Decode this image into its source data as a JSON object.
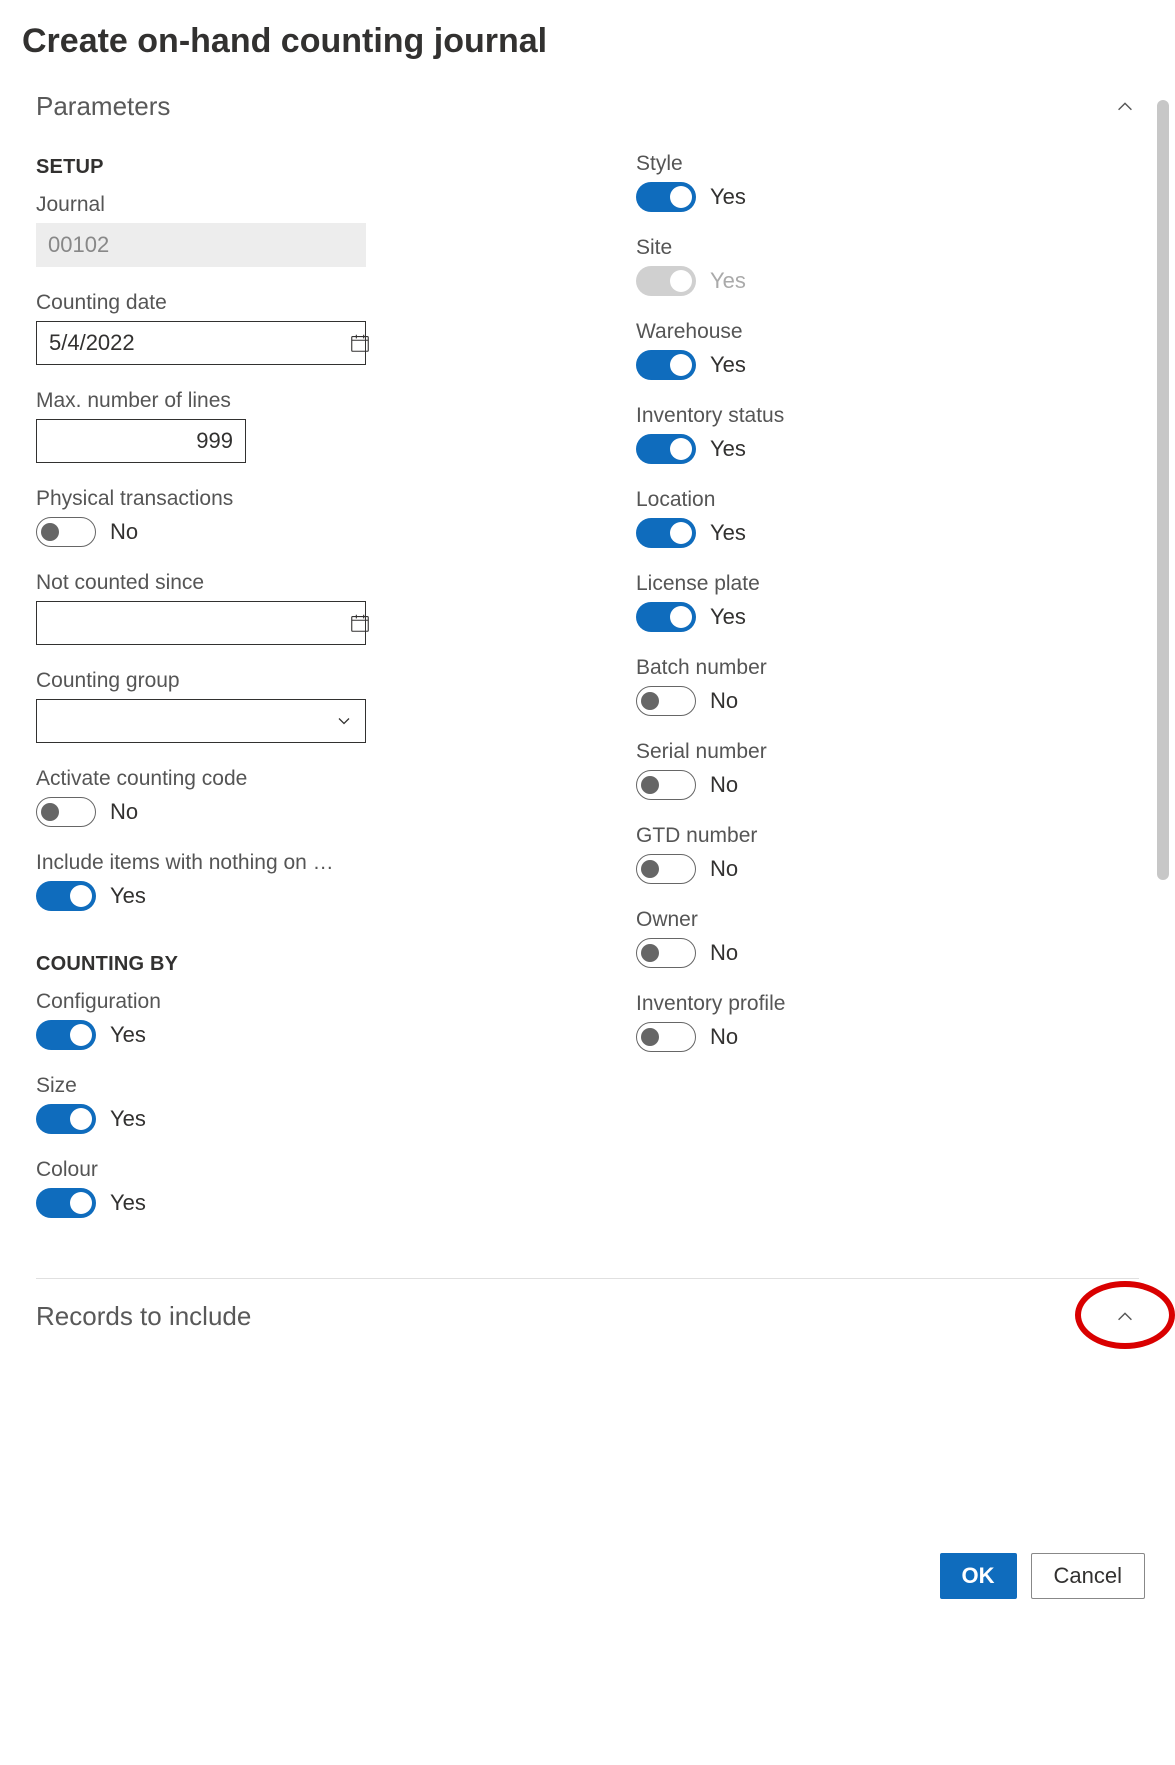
{
  "title": "Create on-hand counting journal",
  "sections": {
    "parameters": {
      "label": "Parameters"
    },
    "records": {
      "label": "Records to include"
    }
  },
  "setup": {
    "heading": "SETUP",
    "journal": {
      "label": "Journal",
      "value": "00102"
    },
    "counting_date": {
      "label": "Counting date",
      "value": "5/4/2022"
    },
    "max_lines": {
      "label": "Max. number of lines",
      "value": "999"
    },
    "physical_transactions": {
      "label": "Physical transactions",
      "value": "No"
    },
    "not_counted_since": {
      "label": "Not counted since",
      "value": ""
    },
    "counting_group": {
      "label": "Counting group",
      "value": ""
    },
    "activate_counting_code": {
      "label": "Activate counting code",
      "value": "No"
    },
    "include_zero": {
      "label": "Include items with nothing on …",
      "value": "Yes"
    }
  },
  "counting_by": {
    "heading": "COUNTING BY",
    "configuration": {
      "label": "Configuration",
      "value": "Yes"
    },
    "size": {
      "label": "Size",
      "value": "Yes"
    },
    "colour": {
      "label": "Colour",
      "value": "Yes"
    },
    "style": {
      "label": "Style",
      "value": "Yes"
    },
    "site": {
      "label": "Site",
      "value": "Yes"
    },
    "warehouse": {
      "label": "Warehouse",
      "value": "Yes"
    },
    "inventory_status": {
      "label": "Inventory status",
      "value": "Yes"
    },
    "location": {
      "label": "Location",
      "value": "Yes"
    },
    "license_plate": {
      "label": "License plate",
      "value": "Yes"
    },
    "batch_number": {
      "label": "Batch number",
      "value": "No"
    },
    "serial_number": {
      "label": "Serial number",
      "value": "No"
    },
    "gtd_number": {
      "label": "GTD number",
      "value": "No"
    },
    "owner": {
      "label": "Owner",
      "value": "No"
    },
    "inventory_profile": {
      "label": "Inventory profile",
      "value": "No"
    }
  },
  "footer": {
    "ok": "OK",
    "cancel": "Cancel"
  }
}
